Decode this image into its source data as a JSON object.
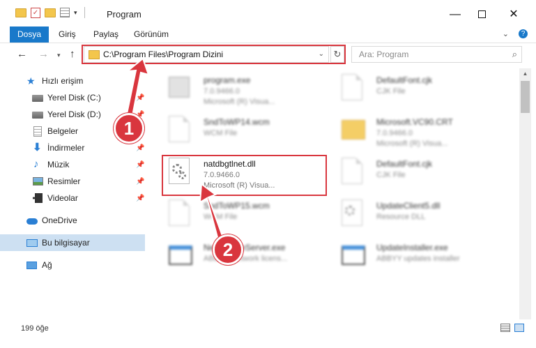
{
  "window": {
    "title": "Program",
    "minimize_glyph": "—",
    "close_glyph": "✕"
  },
  "qat": {
    "check_glyph": "✓",
    "drop_glyph": "▾"
  },
  "ribbon": {
    "tabs": [
      "Dosya",
      "Giriş",
      "Paylaş",
      "Görünüm"
    ],
    "collapse_glyph": "⌄",
    "help_glyph": "?"
  },
  "nav": {
    "back_glyph": "←",
    "forward_glyph": "→",
    "recent_glyph": "▾",
    "up_glyph": "↑",
    "address": "C:\\Program Files\\Program Dizini",
    "address_drop_glyph": "⌄",
    "refresh_glyph": "↻",
    "search_placeholder": "Ara: Program",
    "search_glyph": "⌕"
  },
  "sidebar": {
    "items": [
      {
        "label": "Hızlı erişim",
        "icon": "star-icon",
        "glyph": "★"
      },
      {
        "label": "Yerel Disk (C:)",
        "icon": "disk-icon",
        "pinned": true
      },
      {
        "label": "Yerel Disk (D:)",
        "icon": "disk-icon",
        "pinned": true
      },
      {
        "label": "Belgeler",
        "icon": "documents-icon",
        "pinned": true
      },
      {
        "label": "İndirmeler",
        "icon": "download-icon",
        "glyph": "⬇",
        "pinned": true
      },
      {
        "label": "Müzik",
        "icon": "music-icon",
        "glyph": "♪",
        "pinned": true
      },
      {
        "label": "Resimler",
        "icon": "pictures-icon",
        "pinned": true
      },
      {
        "label": "Videolar",
        "icon": "videos-icon",
        "pinned": true
      },
      {
        "label": "OneDrive",
        "icon": "cloud-icon"
      },
      {
        "label": "Bu bilgisayar",
        "icon": "computer-icon",
        "selected": true
      },
      {
        "label": "Ağ",
        "icon": "network-icon"
      }
    ],
    "pin_glyph": "📌"
  },
  "files": {
    "program_exe": {
      "name": "program.exe",
      "l2": "7.0.9466.0",
      "l3": "Microsoft (R) Visua..."
    },
    "defaultfont1": {
      "name": "DefaultFont.cjk",
      "l2": "CJK File",
      "l3": ""
    },
    "sndtowp14": {
      "name": "SndToWP14.wcm",
      "l2": "WCM File",
      "l3": ""
    },
    "msvc90": {
      "name": "Microsoft.VC90.CRT",
      "l2": "7.0.9466.0",
      "l3": "Microsoft (R) Visua..."
    },
    "natdbgtlnet": {
      "name": "natdbgtlnet.dll",
      "l2": "7.0.9466.0",
      "l3": "Microsoft (R) Visua..."
    },
    "defaultfont2": {
      "name": "DefaultFont.cjk",
      "l2": "CJK File",
      "l3": ""
    },
    "sndtowp15": {
      "name": "SndToWP15.wcm",
      "l2": "WCM File",
      "l3": ""
    },
    "updateclient5": {
      "name": "UpdateClient5.dll",
      "l2": "Resource DLL",
      "l3": ""
    },
    "netlicense": {
      "name": "NetLicenseServer.exe",
      "l2": "ABBYY Network licens...",
      "l3": ""
    },
    "updateinstaller": {
      "name": "UpdateInstaller.exe",
      "l2": "ABBYY updates installer",
      "l3": ""
    }
  },
  "scroll_up_glyph": "▲",
  "annotations": {
    "badge1": "1",
    "badge2": "2",
    "color": "#d9363e"
  },
  "status": {
    "count": "199 öğe"
  },
  "colors": {
    "accent": "#1979ca",
    "selection": "#cde0f2",
    "highlight": "#d9363e"
  }
}
